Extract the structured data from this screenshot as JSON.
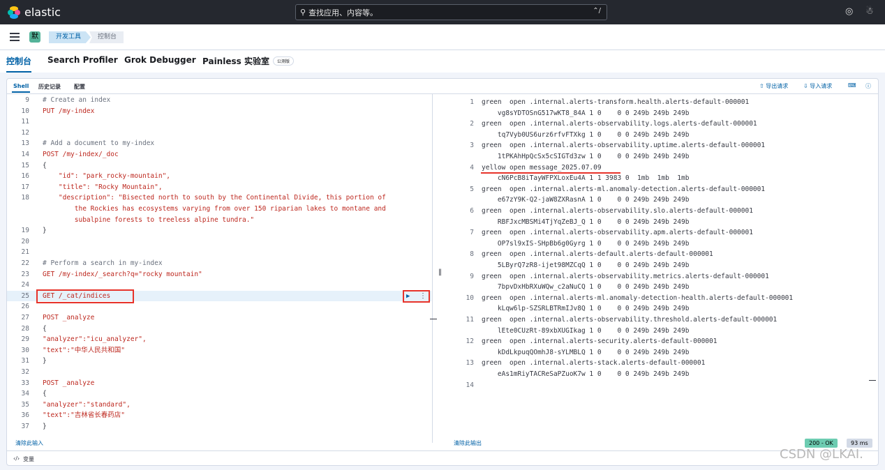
{
  "topbar": {
    "brand": "elastic",
    "search_placeholder": "查找应用、内容等。",
    "search_shortcut": "⌃/"
  },
  "secondary": {
    "avatar_letter": "默",
    "breadcrumbs": [
      "开发工具",
      "控制台"
    ]
  },
  "tabs": [
    {
      "label": "控制台",
      "active": true
    },
    {
      "label": "Search Profiler"
    },
    {
      "label": "Grok Debugger"
    },
    {
      "label": "Painless 实验室",
      "badge": "公测版"
    }
  ],
  "console": {
    "subtabs": [
      "Shell",
      "历史记录",
      "配置"
    ],
    "actions": {
      "export": "导出请求",
      "import": "导入请求"
    },
    "editor_lines": [
      {
        "n": "9",
        "t": "# Create an index",
        "k": "comment"
      },
      {
        "n": "10",
        "t": "PUT /my-index",
        "k": "verb"
      },
      {
        "n": "11",
        "t": ""
      },
      {
        "n": "12",
        "t": ""
      },
      {
        "n": "13",
        "t": "# Add a document to my-index",
        "k": "comment"
      },
      {
        "n": "14",
        "t": "POST /my-index/_doc",
        "k": "verb"
      },
      {
        "n": "15",
        "t": "{",
        "k": "p"
      },
      {
        "n": "16",
        "t": "    \"id\": \"park_rocky-mountain\",",
        "k": "str"
      },
      {
        "n": "17",
        "t": "    \"title\": \"Rocky Mountain\",",
        "k": "str"
      },
      {
        "n": "18",
        "t": "    \"description\": \"Bisected north to south by the Continental Divide, this portion of",
        "k": "str"
      },
      {
        "n": "",
        "t": "        the Rockies has ecosystems varying from over 150 riparian lakes to montane and",
        "k": "str"
      },
      {
        "n": "",
        "t": "        subalpine forests to treeless alpine tundra.\"",
        "k": "str"
      },
      {
        "n": "19",
        "t": "}",
        "k": "p"
      },
      {
        "n": "20",
        "t": ""
      },
      {
        "n": "21",
        "t": ""
      },
      {
        "n": "22",
        "t": "# Perform a search in my-index",
        "k": "comment"
      },
      {
        "n": "23",
        "t": "GET /my-index/_search?q=\"rocky mountain\"",
        "k": "verb"
      },
      {
        "n": "24",
        "t": ""
      },
      {
        "n": "25",
        "t": "GET /_cat/indices",
        "k": "verb",
        "active": true
      },
      {
        "n": "26",
        "t": ""
      },
      {
        "n": "27",
        "t": "POST _analyze",
        "k": "verb"
      },
      {
        "n": "28",
        "t": "{",
        "k": "p"
      },
      {
        "n": "29",
        "t": "\"analyzer\":\"icu_analyzer\",",
        "k": "str"
      },
      {
        "n": "30",
        "t": "\"text\":\"中华人民共和国\"",
        "k": "str"
      },
      {
        "n": "31",
        "t": "}",
        "k": "p"
      },
      {
        "n": "32",
        "t": ""
      },
      {
        "n": "33",
        "t": "POST _analyze",
        "k": "verb"
      },
      {
        "n": "34",
        "t": "{",
        "k": "p"
      },
      {
        "n": "35",
        "t": "\"analyzer\":\"standard\",",
        "k": "str"
      },
      {
        "n": "36",
        "t": "\"text\":\"吉林省长春药店\"",
        "k": "str"
      },
      {
        "n": "37",
        "t": "}",
        "k": "p"
      }
    ],
    "output_lines": [
      {
        "n": "1",
        "t": "green  open .internal.alerts-transform.health.alerts-default-000001"
      },
      {
        "n": "",
        "t": "    vg8sYDTOSnG517wKT8_84A 1 0    0 0 249b 249b 249b"
      },
      {
        "n": "2",
        "t": "green  open .internal.alerts-observability.logs.alerts-default-000001"
      },
      {
        "n": "",
        "t": "    tq7Vyb0US6urz6rfvFTXkg 1 0    0 0 249b 249b 249b"
      },
      {
        "n": "3",
        "t": "green  open .internal.alerts-observability.uptime.alerts-default-000001"
      },
      {
        "n": "",
        "t": "    1tPKAhHpQcSx5cSIGTd3zw 1 0    0 0 249b 249b 249b"
      },
      {
        "n": "4",
        "t": "yellow open message_2025.07.09"
      },
      {
        "n": "",
        "t": "    cN6PcB8iTayWFPXLoxEu4A 1 1 3983 0  1mb  1mb  1mb"
      },
      {
        "n": "5",
        "t": "green  open .internal.alerts-ml.anomaly-detection.alerts-default-000001"
      },
      {
        "n": "",
        "t": "    e67zY9K-Q2-jaW8ZXRasnA 1 0    0 0 249b 249b 249b"
      },
      {
        "n": "6",
        "t": "green  open .internal.alerts-observability.slo.alerts-default-000001"
      },
      {
        "n": "",
        "t": "    RBFJxcMBSMi4TjYqZeBJ_Q 1 0    0 0 249b 249b 249b"
      },
      {
        "n": "7",
        "t": "green  open .internal.alerts-observability.apm.alerts-default-000001"
      },
      {
        "n": "",
        "t": "    OP7sl9xIS-SHpBb6g0Gyrg 1 0    0 0 249b 249b 249b"
      },
      {
        "n": "8",
        "t": "green  open .internal.alerts-default.alerts-default-000001"
      },
      {
        "n": "",
        "t": "    5LByrQ7zR8-ijet98MZCqQ 1 0    0 0 249b 249b 249b"
      },
      {
        "n": "9",
        "t": "green  open .internal.alerts-observability.metrics.alerts-default-000001"
      },
      {
        "n": "",
        "t": "    7bpvDxHbRXuWQw_c2aNuCQ 1 0    0 0 249b 249b 249b"
      },
      {
        "n": "10",
        "t": "green  open .internal.alerts-ml.anomaly-detection-health.alerts-default-000001"
      },
      {
        "n": "",
        "t": "    kLqw6lp-SZSRLBTRmIJv8Q 1 0    0 0 249b 249b 249b"
      },
      {
        "n": "11",
        "t": "green  open .internal.alerts-observability.threshold.alerts-default-000001"
      },
      {
        "n": "",
        "t": "    lEte0CUzRt-89xbXUGIkag 1 0    0 0 249b 249b 249b"
      },
      {
        "n": "12",
        "t": "green  open .internal.alerts-security.alerts-default-000001"
      },
      {
        "n": "",
        "t": "    kDdLkpuqQOmhJ8-sYLMBLQ 1 0    0 0 249b 249b 249b"
      },
      {
        "n": "13",
        "t": "green  open .internal.alerts-stack.alerts-default-000001"
      },
      {
        "n": "",
        "t": "    eAs1mRiyTACReSaPZuoK7w 1 0    0 0 249b 249b 249b"
      },
      {
        "n": "14",
        "t": ""
      }
    ],
    "clear_input": "清除此输入",
    "clear_output": "清除此输出",
    "status": "200 - OK",
    "duration": "93 ms",
    "variables": "变量"
  },
  "watermark": "CSDN @LKAI."
}
